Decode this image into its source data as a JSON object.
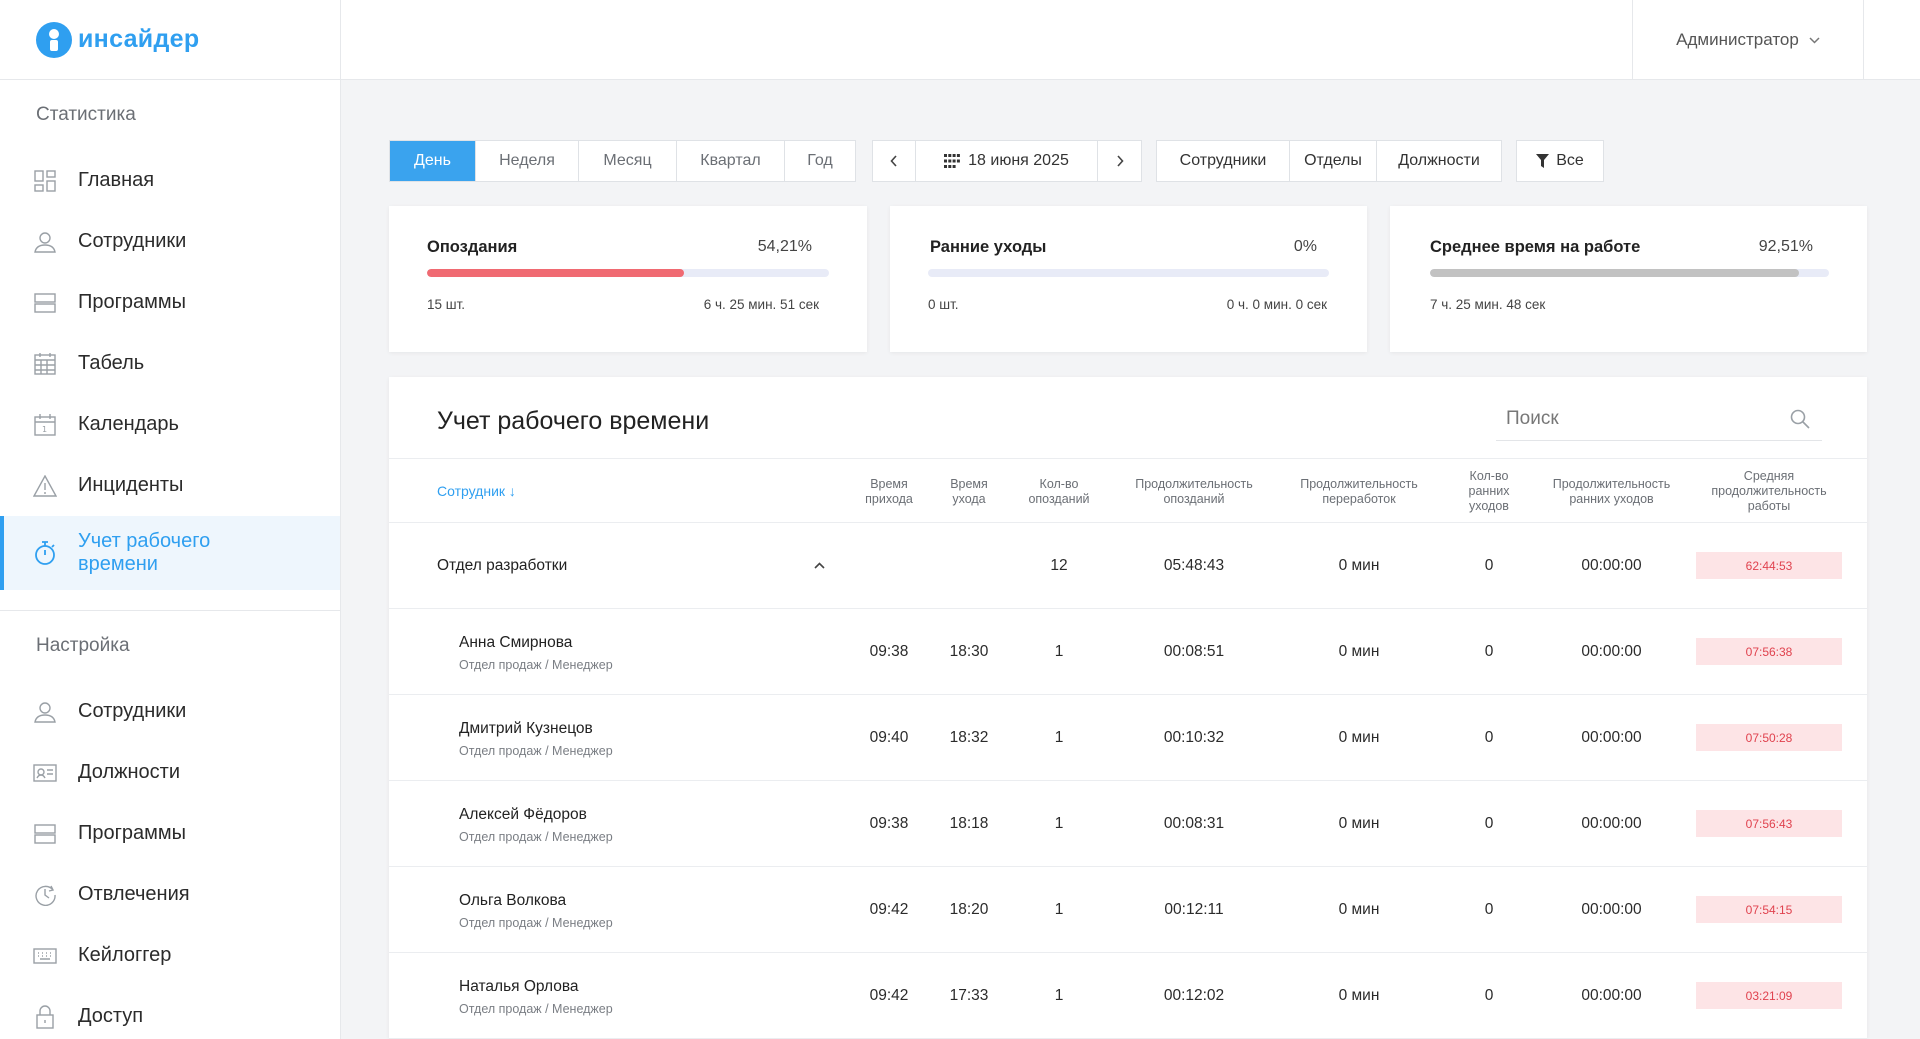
{
  "brand": {
    "name": "инсайдер"
  },
  "colors": {
    "accent": "#2f9ff0",
    "late": "#f06a72",
    "bar_track": "#e8ebf7",
    "avg_fill": "#c2c2c2",
    "badge_bg": "#fde4e6",
    "badge_text": "#e0424e"
  },
  "sidebar": {
    "stats_title": "Статистика",
    "stats_items": [
      {
        "label": "Главная",
        "icon": "dashboard-icon"
      },
      {
        "label": "Сотрудники",
        "icon": "user-icon"
      },
      {
        "label": "Программы",
        "icon": "programs-icon"
      },
      {
        "label": "Табель",
        "icon": "timesheet-icon"
      },
      {
        "label": "Календарь",
        "icon": "calendar-icon"
      },
      {
        "label": "Инциденты",
        "icon": "warning-icon"
      },
      {
        "label": "Учет рабочего времени",
        "icon": "stopwatch-icon",
        "active": true
      }
    ],
    "settings_title": "Настройка",
    "settings_items": [
      {
        "label": "Сотрудники",
        "icon": "user-icon"
      },
      {
        "label": "Должности",
        "icon": "id-card-icon"
      },
      {
        "label": "Программы",
        "icon": "programs-icon"
      },
      {
        "label": "Отвлечения",
        "icon": "clock-icon"
      },
      {
        "label": "Кейлоггер",
        "icon": "keyboard-icon"
      },
      {
        "label": "Доступ",
        "icon": "lock-icon"
      }
    ]
  },
  "header": {
    "user": "Администратор"
  },
  "toolbar": {
    "periods": [
      "День",
      "Неделя",
      "Месяц",
      "Квартал",
      "Год"
    ],
    "active_period": "День",
    "date": "18 июня 2025",
    "views": [
      "Сотрудники",
      "Отделы",
      "Должности"
    ],
    "filter": "Все"
  },
  "cards": [
    {
      "title": "Опоздания",
      "percent": "54,21%",
      "fill": 0.64,
      "left": "15 шт.",
      "right": "6 ч. 25 мин. 51 сек"
    },
    {
      "title": "Ранние уходы",
      "percent": "0%",
      "fill": 0,
      "left": "0 шт.",
      "right": "0 ч. 0 мин. 0 сек"
    },
    {
      "title": "Среднее время на работе",
      "percent": "92,51%",
      "fill": 0.9251,
      "left": "7 ч. 25 мин. 48 сек",
      "right": ""
    }
  ],
  "table": {
    "title": "Учет рабочего времени",
    "search_placeholder": "Поиск",
    "columns": {
      "employee": "Сотрудник ↓",
      "arrival": [
        "Время",
        "прихода"
      ],
      "leave": [
        "Время",
        "ухода"
      ],
      "late_count": [
        "Кол-во",
        "опозданий"
      ],
      "late_duration": [
        "Продолжительность",
        "опозданий"
      ],
      "overtime": [
        "Продолжительность",
        "переработок"
      ],
      "early_count": [
        "Кол-во",
        "ранних",
        "уходов"
      ],
      "early_duration": [
        "Продолжительность",
        "ранних уходов"
      ],
      "avg_work": [
        "Средняя",
        "продолжительность",
        "работы"
      ]
    },
    "group": {
      "name": "Отдел разработки",
      "late_count": "12",
      "late_duration": "05:48:43",
      "overtime": "0 мин",
      "early_count": "0",
      "early_duration": "00:00:00",
      "avg_work": "62:44:53"
    },
    "rows": [
      {
        "name": "Анна Смирнова",
        "sub": "Отдел продаж / Менеджер",
        "arrival": "09:38",
        "leave": "18:30",
        "late_count": "1",
        "late_duration": "00:08:51",
        "overtime": "0 мин",
        "early_count": "0",
        "early_duration": "00:00:00",
        "avg_work": "07:56:38"
      },
      {
        "name": "Дмитрий Кузнецов",
        "sub": "Отдел продаж / Менеджер",
        "arrival": "09:40",
        "leave": "18:32",
        "late_count": "1",
        "late_duration": "00:10:32",
        "overtime": "0 мин",
        "early_count": "0",
        "early_duration": "00:00:00",
        "avg_work": "07:50:28"
      },
      {
        "name": "Алексей Фёдоров",
        "sub": "Отдел продаж / Менеджер",
        "arrival": "09:38",
        "leave": "18:18",
        "late_count": "1",
        "late_duration": "00:08:31",
        "overtime": "0 мин",
        "early_count": "0",
        "early_duration": "00:00:00",
        "avg_work": "07:56:43"
      },
      {
        "name": "Ольга Волкова",
        "sub": "Отдел продаж / Менеджер",
        "arrival": "09:42",
        "leave": "18:20",
        "late_count": "1",
        "late_duration": "00:12:11",
        "overtime": "0 мин",
        "early_count": "0",
        "early_duration": "00:00:00",
        "avg_work": "07:54:15"
      },
      {
        "name": "Наталья Орлова",
        "sub": "Отдел продаж / Менеджер",
        "arrival": "09:42",
        "leave": "17:33",
        "late_count": "1",
        "late_duration": "00:12:02",
        "overtime": "0 мин",
        "early_count": "0",
        "early_duration": "00:00:00",
        "avg_work": "03:21:09"
      }
    ]
  }
}
